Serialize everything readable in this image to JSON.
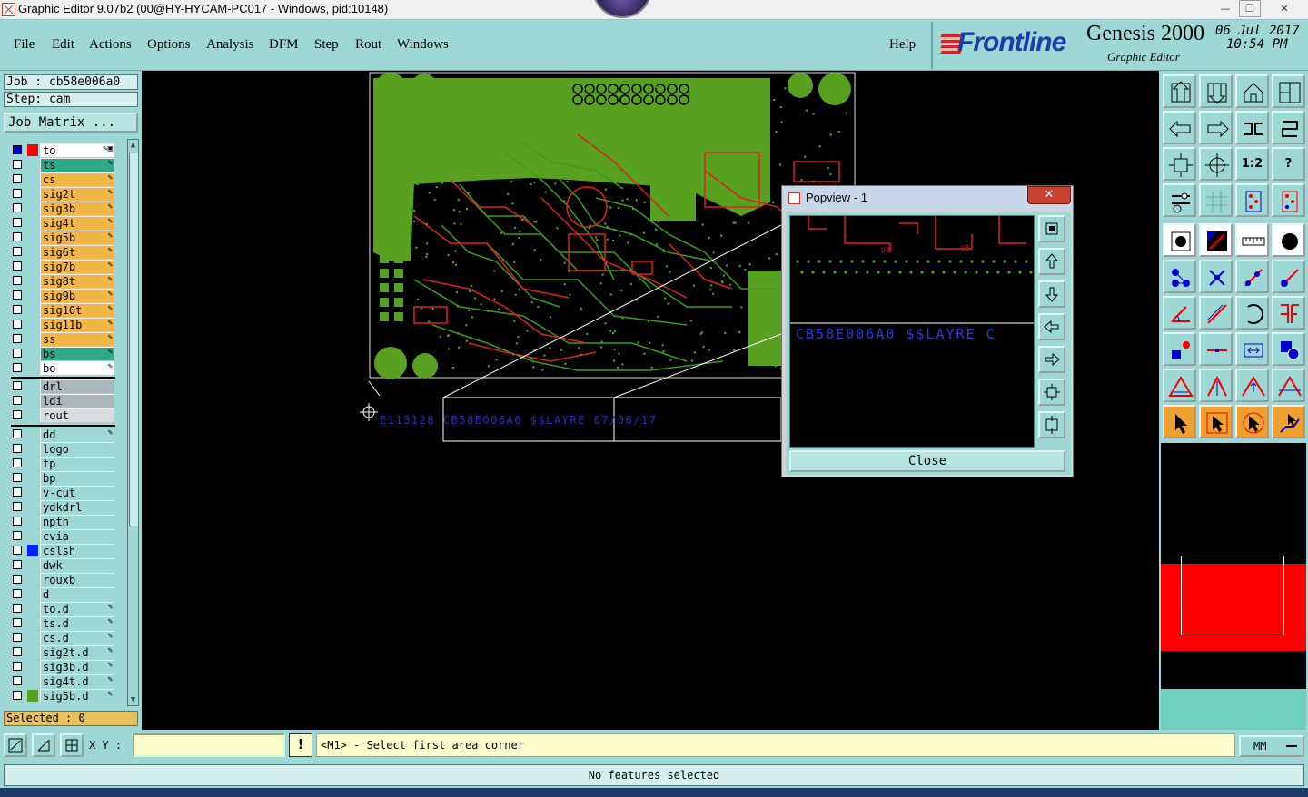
{
  "window": {
    "title": "Graphic Editor 9.07b2 (00@HY-HYCAM-PC017 - Windows, pid:10148)",
    "min": "—",
    "max": "❐",
    "close": "✕"
  },
  "menu": {
    "items": [
      "File",
      "Edit",
      "Actions",
      "Options",
      "Analysis",
      "DFM",
      "Step",
      "Rout",
      "Windows"
    ],
    "help": "Help"
  },
  "brand": {
    "logo": "Frontline",
    "product": "Genesis 2000",
    "subtitle": "Graphic Editor",
    "date": "06 Jul 2017",
    "time": "10:54 PM"
  },
  "job": {
    "job_line": "Job : cb58e006a0",
    "step_line": "Step: cam",
    "matrix_button": "Job Matrix ..."
  },
  "layers": [
    {
      "name": "to",
      "bg": "#ffffff",
      "swatch": "#ff0000",
      "checked": true,
      "pen": "✎▣"
    },
    {
      "name": "ts",
      "bg": "#2fa888",
      "swatch": "",
      "checked": false,
      "pen": "✎"
    },
    {
      "name": "cs",
      "bg": "#f2b646",
      "swatch": "",
      "checked": false,
      "pen": "✎"
    },
    {
      "name": "sig2t",
      "bg": "#f2b646",
      "swatch": "",
      "checked": false,
      "pen": "✎"
    },
    {
      "name": "sig3b",
      "bg": "#f2b646",
      "swatch": "",
      "checked": false,
      "pen": "✎"
    },
    {
      "name": "sig4t",
      "bg": "#f2b646",
      "swatch": "",
      "checked": false,
      "pen": "✎"
    },
    {
      "name": "sig5b",
      "bg": "#f2b646",
      "swatch": "",
      "checked": false,
      "pen": "✎"
    },
    {
      "name": "sig6t",
      "bg": "#f2b646",
      "swatch": "",
      "checked": false,
      "pen": "✎"
    },
    {
      "name": "sig7b",
      "bg": "#f2b646",
      "swatch": "",
      "checked": false,
      "pen": "✎"
    },
    {
      "name": "sig8t",
      "bg": "#f2b646",
      "swatch": "",
      "checked": false,
      "pen": "✎"
    },
    {
      "name": "sig9b",
      "bg": "#f2b646",
      "swatch": "",
      "checked": false,
      "pen": "✎"
    },
    {
      "name": "sig10t",
      "bg": "#f2b646",
      "swatch": "",
      "checked": false,
      "pen": "✎"
    },
    {
      "name": "sig11b",
      "bg": "#f2b646",
      "swatch": "",
      "checked": false,
      "pen": "✎"
    },
    {
      "name": "ss",
      "bg": "#f2b646",
      "swatch": "",
      "checked": false,
      "pen": "✎"
    },
    {
      "name": "bs",
      "bg": "#2fa888",
      "swatch": "",
      "checked": false,
      "pen": "✎"
    },
    {
      "name": "bo",
      "bg": "#ffffff",
      "swatch": "",
      "checked": false,
      "pen": "✎"
    },
    {
      "name": "drl",
      "bg": "#a8b8bc",
      "swatch": "",
      "checked": false,
      "pen": ""
    },
    {
      "name": "ldi",
      "bg": "#a8b8bc",
      "swatch": "",
      "checked": false,
      "pen": ""
    },
    {
      "name": "rout",
      "bg": "#d8dcdc",
      "swatch": "",
      "checked": false,
      "pen": ""
    },
    {
      "name": "dd",
      "bg": "#9ed8d6",
      "swatch": "",
      "checked": false,
      "pen": "✎"
    },
    {
      "name": "logo",
      "bg": "#9ed8d6",
      "swatch": "",
      "checked": false,
      "pen": ""
    },
    {
      "name": "tp",
      "bg": "#9ed8d6",
      "swatch": "",
      "checked": false,
      "pen": ""
    },
    {
      "name": "bp",
      "bg": "#9ed8d6",
      "swatch": "",
      "checked": false,
      "pen": ""
    },
    {
      "name": "v-cut",
      "bg": "#9ed8d6",
      "swatch": "",
      "checked": false,
      "pen": ""
    },
    {
      "name": "ydkdrl",
      "bg": "#9ed8d6",
      "swatch": "",
      "checked": false,
      "pen": ""
    },
    {
      "name": "npth",
      "bg": "#9ed8d6",
      "swatch": "",
      "checked": false,
      "pen": ""
    },
    {
      "name": "cvia",
      "bg": "#9ed8d6",
      "swatch": "",
      "checked": false,
      "pen": ""
    },
    {
      "name": "cslsh",
      "bg": "#9ed8d6",
      "swatch": "#0022ff",
      "checked": false,
      "pen": ""
    },
    {
      "name": "dwk",
      "bg": "#9ed8d6",
      "swatch": "",
      "checked": false,
      "pen": ""
    },
    {
      "name": "rouxb",
      "bg": "#9ed8d6",
      "swatch": "",
      "checked": false,
      "pen": ""
    },
    {
      "name": "d",
      "bg": "#9ed8d6",
      "swatch": "",
      "checked": false,
      "pen": ""
    },
    {
      "name": "to.d",
      "bg": "#9ed8d6",
      "swatch": "",
      "checked": false,
      "pen": "✎"
    },
    {
      "name": "ts.d",
      "bg": "#9ed8d6",
      "swatch": "",
      "checked": false,
      "pen": "✎"
    },
    {
      "name": "cs.d",
      "bg": "#9ed8d6",
      "swatch": "",
      "checked": false,
      "pen": "✎"
    },
    {
      "name": "sig2t.d",
      "bg": "#9ed8d6",
      "swatch": "",
      "checked": false,
      "pen": "✎"
    },
    {
      "name": "sig3b.d",
      "bg": "#9ed8d6",
      "swatch": "",
      "checked": false,
      "pen": "✎"
    },
    {
      "name": "sig4t.d",
      "bg": "#9ed8d6",
      "swatch": "",
      "checked": false,
      "pen": "✎"
    },
    {
      "name": "sig5b.d",
      "bg": "#9ed8d6",
      "swatch": "#58a020",
      "checked": false,
      "pen": "✎"
    }
  ],
  "selected": "Selected : 0",
  "canvas": {
    "board_text": "E113128 CB58E006A0 $$LAYRE 07/06/17",
    "colors": {
      "copper_fill": "#58a020",
      "trace_green": "#3c9c1e",
      "trace_red": "#e02020",
      "text_blue": "#2030c0"
    }
  },
  "popview": {
    "title": "Popview - 1",
    "view_text": "CB58E006A0 $$LAYRE C",
    "labels": [
      "U4",
      "U5"
    ],
    "close_label": "Close",
    "icons": [
      "zoom-home-icon",
      "pan-up-icon",
      "pan-down-icon",
      "pan-left-icon",
      "pan-right-icon",
      "zoom-in-icon",
      "zoom-out-icon"
    ]
  },
  "toolbar": {
    "buttons": [
      {
        "icon": "pan-up-icon",
        "style": "teal"
      },
      {
        "icon": "pan-down-icon",
        "style": "teal"
      },
      {
        "icon": "home-icon",
        "style": "teal"
      },
      {
        "icon": "window-split-icon",
        "style": "teal"
      },
      {
        "icon": "pan-left-icon",
        "style": "teal"
      },
      {
        "icon": "pan-right-icon",
        "style": "teal"
      },
      {
        "icon": "mirror-icon",
        "style": "teal"
      },
      {
        "icon": "redraw-icon",
        "style": "teal"
      },
      {
        "icon": "zoom-fit-icon",
        "style": "teal"
      },
      {
        "icon": "zoom-area-icon",
        "style": "teal"
      },
      {
        "icon": "scale-icon",
        "style": "teal",
        "text": "1:2"
      },
      {
        "icon": "help-icon",
        "style": "teal",
        "text": "?"
      },
      {
        "icon": "tools-icon",
        "style": "teal"
      },
      {
        "icon": "grid-icon",
        "style": "teal"
      },
      {
        "icon": "layers-icon",
        "style": "teal"
      },
      {
        "icon": "layers-active-icon",
        "style": "teal"
      },
      {
        "icon": "pad-icon",
        "style": "white"
      },
      {
        "icon": "line-icon",
        "style": "white"
      },
      {
        "icon": "ruler-icon",
        "style": "white"
      },
      {
        "icon": "circle-icon",
        "style": "white"
      },
      {
        "icon": "nodes-icon",
        "style": "teal"
      },
      {
        "icon": "cross-icon",
        "style": "teal"
      },
      {
        "icon": "segment-icon",
        "style": "teal"
      },
      {
        "icon": "segment-add-icon",
        "style": "teal"
      },
      {
        "icon": "angle-icon",
        "style": "teal"
      },
      {
        "icon": "diagonal-icon",
        "style": "teal"
      },
      {
        "icon": "arc-icon",
        "style": "teal"
      },
      {
        "icon": "text-frame-icon",
        "style": "teal"
      },
      {
        "icon": "pad-move-icon",
        "style": "teal"
      },
      {
        "icon": "line-break-icon",
        "style": "teal"
      },
      {
        "icon": "measure-icon",
        "style": "teal"
      },
      {
        "icon": "shapes-icon",
        "style": "teal"
      },
      {
        "icon": "triangle-1-icon",
        "style": "teal"
      },
      {
        "icon": "triangle-2-icon",
        "style": "teal"
      },
      {
        "icon": "triangle-3-icon",
        "style": "teal"
      },
      {
        "icon": "triangle-4-icon",
        "style": "teal"
      },
      {
        "icon": "pointer-icon",
        "style": "orange"
      },
      {
        "icon": "pointer-frame-icon",
        "style": "orange"
      },
      {
        "icon": "pointer-rotate-icon",
        "style": "orange"
      },
      {
        "icon": "pointer-route-icon",
        "style": "orange"
      }
    ]
  },
  "bottom": {
    "xy_label": "X Y :",
    "xy_value": "",
    "warn": "!",
    "prompt": "<M1> - Select first area corner",
    "units": "MM",
    "status": "No features selected"
  }
}
